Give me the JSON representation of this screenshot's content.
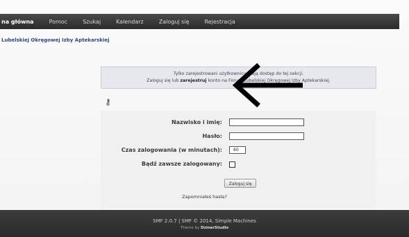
{
  "nav": {
    "items": [
      "na główna",
      "Pomoc",
      "Szukaj",
      "Kalendarz",
      "Zaloguj się",
      "Rejestracja"
    ]
  },
  "forum_title": "Lubelskiej Okręgowej Izby Aptekarskiej",
  "notice": {
    "line1": "Tylko zarejestrowani użytkownicy mają dostęp do tej sekcji.",
    "line2_prefix": "Zaloguj się lub",
    "line2_link": "zarejestruj",
    "line2_suffix": "konto na Forum Lubelskiej Okręgowej Izby Aptekarskiej."
  },
  "form": {
    "name_label": "Nazwisko i imię:",
    "password_label": "Hasło:",
    "duration_label": "Czas zalogowania (w minutach):",
    "duration_value": "60",
    "always_label": "Bądź zawsze zalogowany:",
    "submit_label": "Zaloguj się",
    "forgot_label": "Zapomniałeś hasła?"
  },
  "footer": {
    "line1": "SMF 2.0.7 | SMF © 2014, Simple Machines",
    "line2_prefix": "Theme by",
    "line2_brand": "DzinerStudio"
  },
  "colors": {
    "nav_bg": "#2b2b2b",
    "title": "#2e4b7a",
    "arrow": "#000000"
  }
}
